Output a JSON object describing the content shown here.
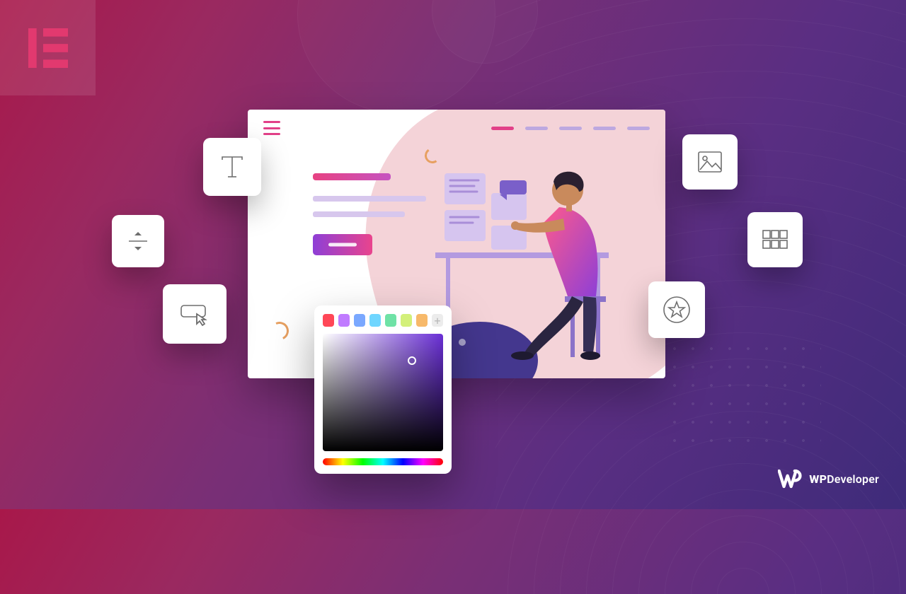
{
  "brand": {
    "bold": "WP",
    "rest": "Developer"
  },
  "tools": {
    "type": "text-tool-icon",
    "spacer": "spacer-tool-icon",
    "cursor": "button-tool-icon",
    "image": "image-tool-icon",
    "grid": "gallery-tool-icon",
    "star": "star-rating-tool-icon"
  },
  "picker": {
    "swatches": [
      "#ff4757",
      "#c07bff",
      "#7aa8ff",
      "#6fd6ff",
      "#6fe2a6",
      "#d3f07a",
      "#f7b96a"
    ],
    "add_label": "+"
  }
}
